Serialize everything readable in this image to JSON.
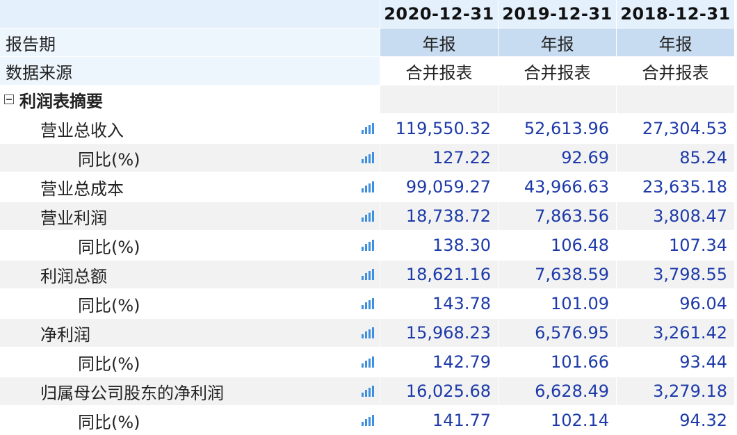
{
  "header": {
    "periods": [
      "2020-12-31",
      "2019-12-31",
      "2018-12-31"
    ]
  },
  "meta_rows": {
    "report_period": {
      "label": "报告期",
      "values": [
        "年报",
        "年报",
        "年报"
      ]
    },
    "data_source": {
      "label": "数据来源",
      "values": [
        "合并报表",
        "合并报表",
        "合并报表"
      ]
    }
  },
  "section": {
    "label": "利润表摘要",
    "collapse_icon": "minus-box-icon"
  },
  "rows": [
    {
      "label": "营业总收入",
      "values": [
        "119,550.32",
        "52,613.96",
        "27,304.53"
      ]
    },
    {
      "label": "同比(%)",
      "values": [
        "127.22",
        "92.69",
        "85.24"
      ]
    },
    {
      "label": "营业总成本",
      "values": [
        "99,059.27",
        "43,966.63",
        "23,635.18"
      ]
    },
    {
      "label": "营业利润",
      "values": [
        "18,738.72",
        "7,863.56",
        "3,808.47"
      ]
    },
    {
      "label": "同比(%)",
      "values": [
        "138.30",
        "106.48",
        "107.34"
      ]
    },
    {
      "label": "利润总额",
      "values": [
        "18,621.16",
        "7,638.59",
        "3,798.55"
      ]
    },
    {
      "label": "同比(%)",
      "values": [
        "143.78",
        "101.09",
        "96.04"
      ]
    },
    {
      "label": "净利润",
      "values": [
        "15,968.23",
        "6,576.95",
        "3,261.42"
      ]
    },
    {
      "label": "同比(%)",
      "values": [
        "142.79",
        "101.66",
        "93.44"
      ]
    },
    {
      "label": "归属母公司股东的净利润",
      "values": [
        "16,025.68",
        "6,628.49",
        "3,279.18"
      ]
    },
    {
      "label": "同比(%)",
      "values": [
        "141.77",
        "102.14",
        "94.32"
      ]
    }
  ],
  "colors": {
    "value_text": "#1d3aa8",
    "header_bg": "#e4f0fb",
    "period_bg": "#c7dcf1",
    "icon": "#3d8fe0"
  },
  "icons": {
    "chart": "bar-chart-icon"
  }
}
